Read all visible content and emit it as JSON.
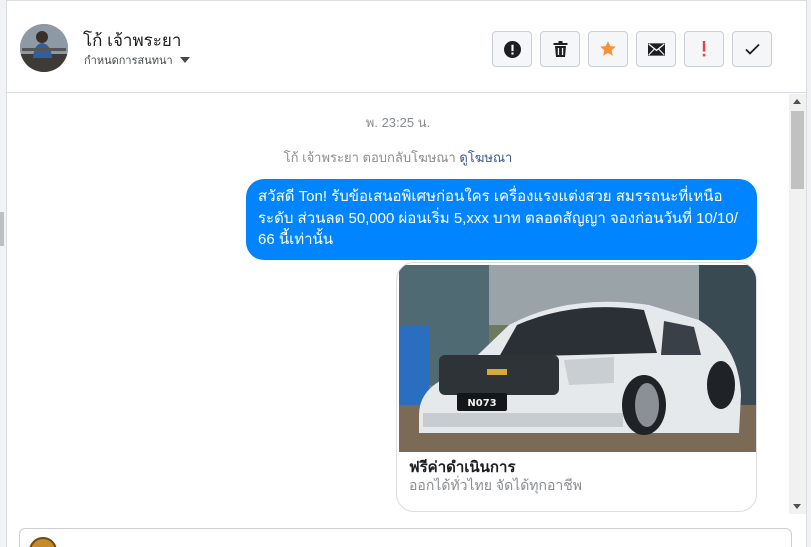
{
  "conversation": {
    "contact_name": "โก้ เจ้าพระยา",
    "assign_label": "กำหนดการสนทนา"
  },
  "actions": [
    {
      "icon": "exclamation-circle-icon",
      "color": "#1c1e21"
    },
    {
      "icon": "trash-icon",
      "color": "#1c1e21"
    },
    {
      "icon": "star-icon",
      "color": "#f7923b"
    },
    {
      "icon": "mail-icon",
      "color": "#1c1e21"
    },
    {
      "icon": "exclamation-icon",
      "color": "#fa383e"
    },
    {
      "icon": "checkmark-icon",
      "color": "#1c1e21"
    }
  ],
  "thread": {
    "timestamp": "พ. 23:25 น.",
    "reply_note": "โก้ เจ้าพระยา ตอบกลับโฆษณา",
    "reply_link": "ดูโฆษณา",
    "message": "สวัสดี Ton! รับข้อเสนอพิเศษก่อนใคร เครื่องแรงแต่งสวย สมรรถนะที่เหนือระดับ ส่วนลด 50,000 ผ่อนเริ่ม 5,xxx บาท ตลอดสัญญา จองก่อนวันที่ 10/10/ 66 นี้เท่านั้น",
    "card": {
      "title": "ฟรีค่าดำเนินการ",
      "subtitle": "ออกได้ทั่วไทย จัดได้ทุกอาชีพ",
      "plate_text": "N073"
    }
  },
  "colors": {
    "bubble": "#0084ff",
    "link": "#385898",
    "accent_star": "#f7923b",
    "accent_alert": "#fa383e"
  }
}
